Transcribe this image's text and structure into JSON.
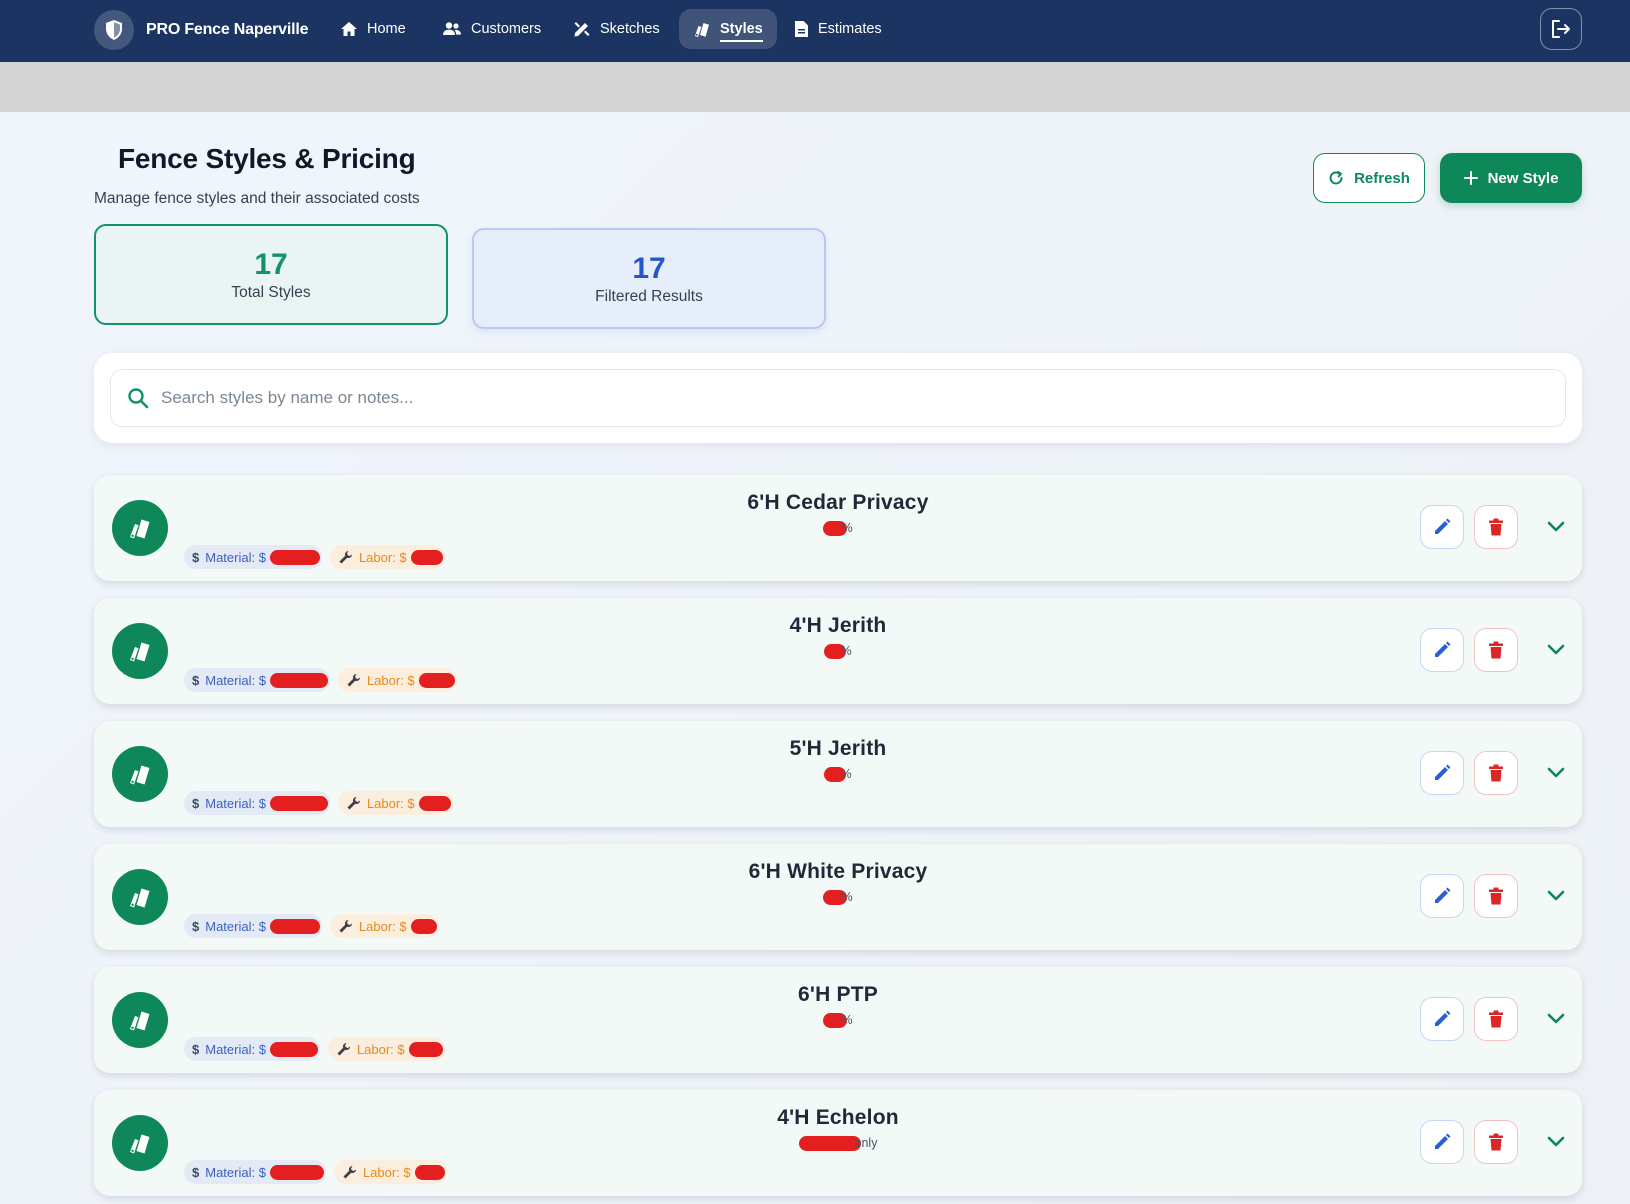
{
  "app": {
    "brand": "PRO Fence Naperville",
    "icons": {
      "brand": "shield-icon",
      "logout": "logout-icon"
    }
  },
  "nav": [
    {
      "label": "Home",
      "icon": "home-icon",
      "active": false
    },
    {
      "label": "Customers",
      "icon": "users-icon",
      "active": false
    },
    {
      "label": "Sketches",
      "icon": "pen-ruler-icon",
      "active": false
    },
    {
      "label": "Styles",
      "icon": "swatchbook-icon",
      "active": true
    },
    {
      "label": "Estimates",
      "icon": "document-icon",
      "active": false
    }
  ],
  "header": {
    "title": "Fence Styles & Pricing",
    "subtitle": "Manage fence styles and their associated costs",
    "refresh_label": "Refresh",
    "new_style_label": "New Style"
  },
  "stats": {
    "total_value": "17",
    "total_label": "Total Styles",
    "filtered_value": "17",
    "filtered_label": "Filtered Results"
  },
  "search": {
    "placeholder": "Search styles by name or notes...",
    "value": ""
  },
  "colors": {
    "nav_bg": "#1c3461",
    "accent_green": "#0e8759",
    "accent_blue": "#2657c8",
    "danger_red": "#dc2626",
    "labor_orange": "#e48b1c"
  },
  "styles": [
    {
      "name": "6'H Cedar Privacy",
      "note_suffix": "%",
      "material_prefix": "Material: $",
      "labor_prefix": "Labor: $"
    },
    {
      "name": "4'H Jerith",
      "note_suffix": "%",
      "material_prefix": "Material: $",
      "labor_prefix": "Labor: $"
    },
    {
      "name": "5'H Jerith",
      "note_suffix": "%",
      "material_prefix": "Material: $",
      "labor_prefix": "Labor: $"
    },
    {
      "name": "6'H White Privacy",
      "note_suffix": "%",
      "material_prefix": "Material: $",
      "labor_prefix": "Labor: $"
    },
    {
      "name": "6'H PTP",
      "note_suffix": "%",
      "material_prefix": "Material: $",
      "labor_prefix": "Labor: $"
    },
    {
      "name": "4'H Echelon",
      "note_suffix": "only",
      "material_prefix": "Material: $",
      "labor_prefix": "Labor: $"
    }
  ]
}
